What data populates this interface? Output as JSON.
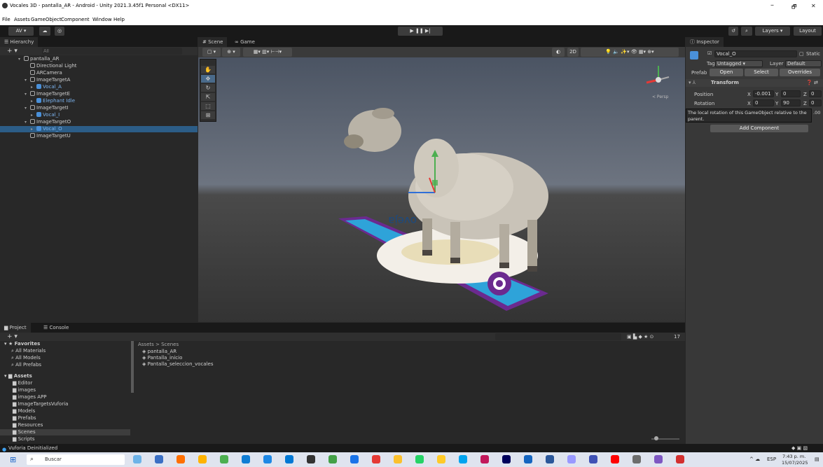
{
  "window": {
    "title": "Vocales 3D - pantalla_AR - Android - Unity 2021.3.45f1 Personal <DX11>",
    "minimize": "–",
    "restore": "🗗",
    "close": "✕"
  },
  "menu": [
    "File",
    "Assets",
    "GameObject",
    "Component",
    "Window",
    "Help"
  ],
  "toolbar": {
    "account": "AV ▾",
    "play": "▶ ❚❚ ▶|",
    "layers": "Layers",
    "layout": "Layout"
  },
  "hierarchy": {
    "tab": "Hierarchy",
    "search_placeholder": "All",
    "rows": [
      {
        "label": "pantalla_AR",
        "indent": 0,
        "kind": "scene",
        "expanded": true
      },
      {
        "label": "Directional Light",
        "indent": 1,
        "kind": "go"
      },
      {
        "label": "ARCamera",
        "indent": 1,
        "kind": "go"
      },
      {
        "label": "ImageTargetA",
        "indent": 1,
        "kind": "go",
        "expanded": true
      },
      {
        "label": "Vocal_A",
        "indent": 2,
        "kind": "prefab",
        "blue": true
      },
      {
        "label": "ImageTargetE",
        "indent": 1,
        "kind": "go",
        "expanded": true
      },
      {
        "label": "Elephant Idle",
        "indent": 2,
        "kind": "prefab",
        "blue": true
      },
      {
        "label": "ImageTargetI",
        "indent": 1,
        "kind": "go",
        "expanded": true
      },
      {
        "label": "Vocal_I",
        "indent": 2,
        "kind": "prefab",
        "blue": true
      },
      {
        "label": "ImageTargetO",
        "indent": 1,
        "kind": "go",
        "expanded": true
      },
      {
        "label": "Vocal_O",
        "indent": 2,
        "kind": "prefab",
        "blue": true,
        "selected": true
      },
      {
        "label": "ImageTargetU",
        "indent": 1,
        "kind": "go"
      }
    ]
  },
  "scene_tabs": {
    "scene": "Scene",
    "game": "Game",
    "mode_2d": "2D",
    "persp": "< Persp"
  },
  "card_word": "oveja",
  "inspector": {
    "tab": "Inspector",
    "object_name": "Vocal_O",
    "static": "Static",
    "tag_label": "Tag",
    "tag": "Untagged",
    "layer_label": "Layer",
    "layer": "Default",
    "prefab_label": "Prefab",
    "open": "Open",
    "select": "Select",
    "overrides": "Overrides",
    "transform": "Transform",
    "position_label": "Position",
    "rotation_label": "Rotation",
    "pos": {
      "x": "-0.001",
      "y": "0",
      "z": "0"
    },
    "rot": {
      "x": "0",
      "y": "90",
      "z": "0"
    },
    "tooltip": "The local rotation of this GameObject relative to the parent.",
    "tooltip_suffix": ".00",
    "add_component": "Add Component"
  },
  "project": {
    "tab_project": "Project",
    "tab_console": "Console",
    "count": "17",
    "breadcrumb": "Assets > Scenes",
    "favorites_label": "Favorites",
    "favorites": [
      "All Materials",
      "All Models",
      "All Prefabs"
    ],
    "assets_label": "Assets",
    "folders": [
      "Editor",
      "images",
      "images APP",
      "ImageTargetsVuforia",
      "Models",
      "Prefabs",
      "Resources",
      "Scenes",
      "Scripts"
    ],
    "files": [
      "pantalla_AR",
      "Pantalla_inicio",
      "Pantalla_seleccion_vocales"
    ]
  },
  "status": "Vuforia Deinitialized",
  "taskbar": {
    "search": "Buscar",
    "lang": "ESP",
    "time": "7:43 p. m.",
    "date": "15/07/2025"
  }
}
